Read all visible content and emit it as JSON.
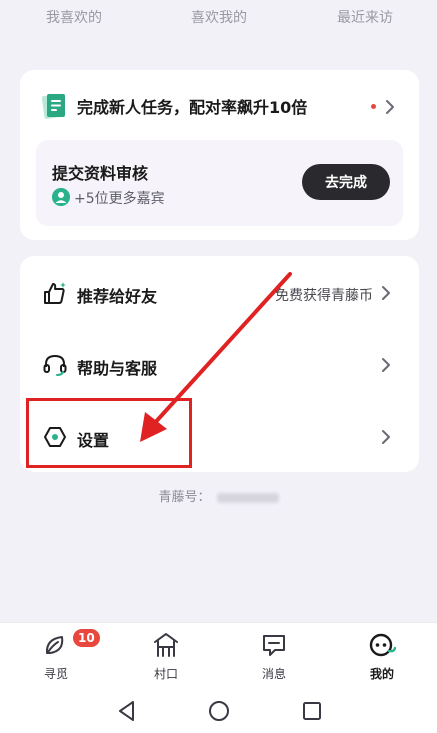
{
  "top_tabs": [
    "我喜欢的",
    "喜欢我的",
    "最近来访"
  ],
  "task_card": {
    "title": "完成新人任务，配对率飙升10倍",
    "review_title": "提交资料审核",
    "guest_text": "+5位更多嘉宾",
    "button_label": "去完成"
  },
  "menu": {
    "items": [
      {
        "label": "推荐给好友",
        "hint": "免费获得青藤币",
        "icon": "thumbs-up-icon"
      },
      {
        "label": "帮助与客服",
        "hint": "",
        "icon": "headset-icon"
      },
      {
        "label": "设置",
        "hint": "",
        "icon": "settings-hexagon-icon"
      }
    ]
  },
  "account": {
    "label": "青藤号："
  },
  "tabbar": {
    "items": [
      {
        "label": "寻觅",
        "badge": "10",
        "icon": "leaf-icon"
      },
      {
        "label": "村口",
        "badge": "",
        "icon": "gate-icon"
      },
      {
        "label": "消息",
        "badge": "",
        "icon": "chat-icon"
      },
      {
        "label": "我的",
        "badge": "",
        "icon": "face-icon",
        "active": true
      }
    ]
  },
  "colors": {
    "accent_green": "#29b28c",
    "dark_button": "#2a2a2e",
    "badge_red": "#e8473e",
    "annotation_red": "#e02222",
    "background": "#f3f1f8"
  }
}
